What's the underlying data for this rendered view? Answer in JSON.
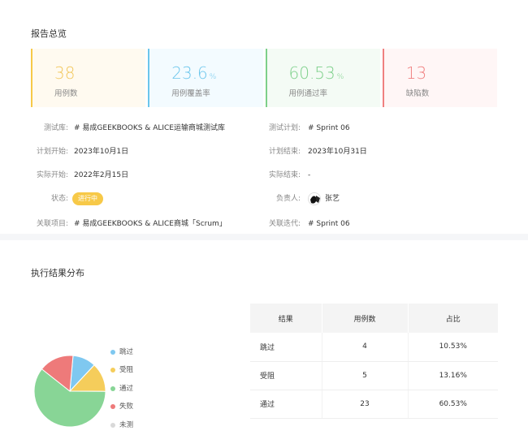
{
  "overview": {
    "title": "报告总览",
    "stats": [
      {
        "value": "38",
        "unit": "",
        "label": "用例数",
        "color": "#f7c948",
        "bg": "#fffaf0",
        "text_color": "#f2c75c"
      },
      {
        "value": "23.6",
        "unit": "%",
        "label": "用例覆盖率",
        "color": "#6cc6ec",
        "bg": "#f3fbff",
        "text_color": "#6cc6ec"
      },
      {
        "value": "60.53",
        "unit": "%",
        "label": "用例通过率",
        "color": "#7dd08a",
        "bg": "#f4fbf5",
        "text_color": "#7dd08a"
      },
      {
        "value": "13",
        "unit": "",
        "label": "缺陷数",
        "color": "#f08080",
        "bg": "#fff6f6",
        "text_color": "#f08080"
      }
    ],
    "info": {
      "repo_label": "测试库:",
      "repo_value": "# 易成GEEKBOOKS & ALICE运输商城测试库",
      "plan_label": "测试计划:",
      "plan_value": "# Sprint 06",
      "plan_start_label": "计划开始:",
      "plan_start_value": "2023年10月1日",
      "plan_end_label": "计划结束:",
      "plan_end_value": "2023年10月31日",
      "actual_start_label": "实际开始:",
      "actual_start_value": "2022年2月15日",
      "actual_end_label": "实际结束:",
      "actual_end_value": "-",
      "status_label": "状态:",
      "status_value": "进行中",
      "owner_label": "负责人:",
      "owner_value": "张艺",
      "project_label": "关联项目:",
      "project_value": "# 易成GEEKBOOKS & ALICE商城「Scrum」",
      "iteration_label": "关联迭代:",
      "iteration_value": "# Sprint 06"
    }
  },
  "distribution": {
    "title": "执行结果分布",
    "legend": [
      {
        "label": "跳过",
        "color": "#7fc8f0"
      },
      {
        "label": "受阻",
        "color": "#f5cd5b"
      },
      {
        "label": "通过",
        "color": "#88d596"
      },
      {
        "label": "失败",
        "color": "#ee7a7a"
      },
      {
        "label": "未测",
        "color": "#d9d9d9"
      }
    ],
    "table": {
      "headers": [
        "结果",
        "用例数",
        "占比"
      ],
      "rows": [
        [
          "跳过",
          "4",
          "10.53%"
        ],
        [
          "受阻",
          "5",
          "13.16%"
        ],
        [
          "通过",
          "23",
          "60.53%"
        ]
      ]
    }
  },
  "chart_data": {
    "type": "pie",
    "categories": [
      "跳过",
      "受阻",
      "通过",
      "失败",
      "未测"
    ],
    "values": [
      4,
      5,
      23,
      6,
      0
    ]
  }
}
